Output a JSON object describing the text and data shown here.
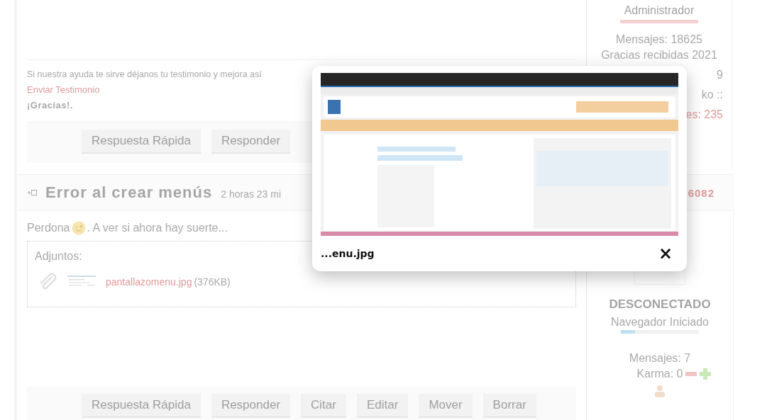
{
  "post1": {
    "signature": {
      "text": "Si nuestra ayuda te sirve déjanos tu testimonio y mejora así",
      "link": "Enviar Testimonio",
      "thanks": "¡Gracias!."
    },
    "actions": [
      "Respuesta Rápida",
      "Responder"
    ],
    "author": {
      "rank": "Administrador",
      "lines": [
        "Mensajes: 18625",
        "Gracias recibidas 2021"
      ],
      "fragments": [
        {
          "kind": "text",
          "text": "9"
        },
        {
          "kind": "text",
          "text": "ko ::"
        },
        {
          "kind": "link",
          "text": "es: 235"
        }
      ]
    }
  },
  "post2": {
    "header": {
      "title": "Error al crear menús",
      "time": "2 horas 23 mi",
      "side": "6082"
    },
    "body": {
      "before": "Perdona",
      "after": ". A ver si ahora hay suerte..."
    },
    "attachments": {
      "label": "Adjuntos:",
      "file": "pantallazomenu.jpg",
      "size": "(376KB)"
    },
    "actions": [
      "Respuesta Rápida",
      "Responder",
      "Citar",
      "Editar",
      "Mover",
      "Borrar"
    ],
    "author": {
      "status": "DESCONECTADO",
      "browser": "Navegador Iniciado",
      "level": 0.18,
      "posts": "Mensajes: 7",
      "karma": "Karma: 0"
    }
  },
  "lightbox": {
    "caption": "...enu.jpg",
    "close": "×"
  }
}
